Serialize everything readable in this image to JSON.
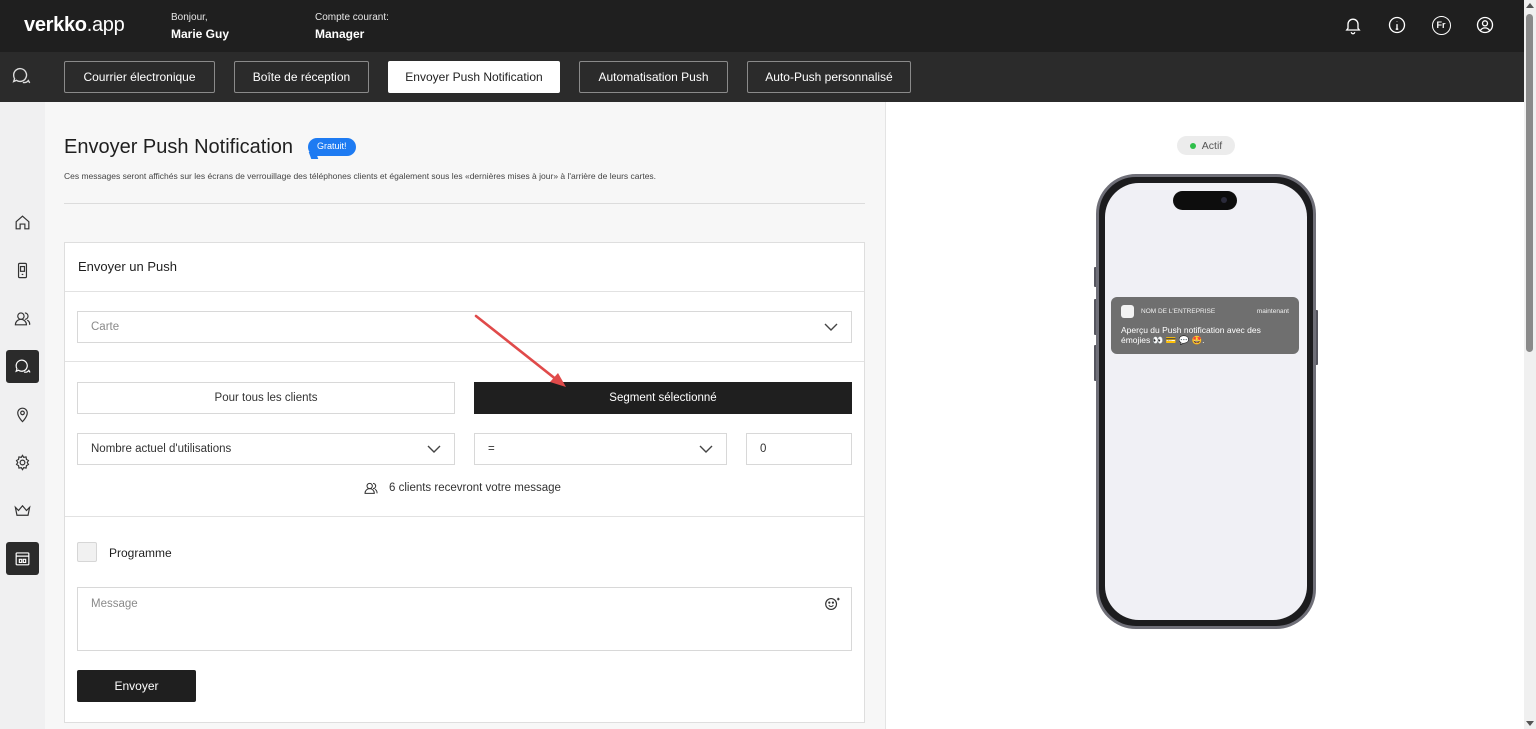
{
  "header": {
    "logo_bold": "verkko",
    "logo_rest": ".app",
    "greeting_label": "Bonjour,",
    "user_name": "Marie Guy",
    "account_label": "Compte courant:",
    "account_role": "Manager",
    "language_code": "Fr"
  },
  "tabs": [
    {
      "label": "Courrier électronique"
    },
    {
      "label": "Boîte de réception"
    },
    {
      "label": "Envoyer Push Notification"
    },
    {
      "label": "Automatisation Push"
    },
    {
      "label": "Auto-Push personnalisé"
    }
  ],
  "page": {
    "title": "Envoyer Push Notification",
    "badge": "Gratuit!",
    "subtitle": "Ces messages seront affichés sur les écrans de verrouillage des téléphones clients et également sous les «dernières mises à jour» à l'arrière de leurs cartes."
  },
  "form": {
    "card_title": "Envoyer un Push",
    "card_select_placeholder": "Carte",
    "all_clients_label": "Pour tous les clients",
    "segment_label": "Segment sélectionné",
    "criterion_value": "Nombre actuel d'utilisations",
    "operator_value": "=",
    "number_value": "0",
    "recipients_text": "6 clients recevront votre message",
    "schedule_label": "Programme",
    "message_placeholder": "Message",
    "send_label": "Envoyer"
  },
  "preview": {
    "status": "Actif",
    "notification_company": "NOM DE L'ENTREPRISE",
    "notification_time": "maintenant",
    "notification_text": "Aperçu du Push notification avec des émojies 👀 💳 💬 🤩."
  },
  "colors": {
    "dark": "#1f1f1f",
    "badge_blue": "#1e7bf2",
    "status_green": "#2fbf4a",
    "annotation_red": "#e04a4a"
  }
}
